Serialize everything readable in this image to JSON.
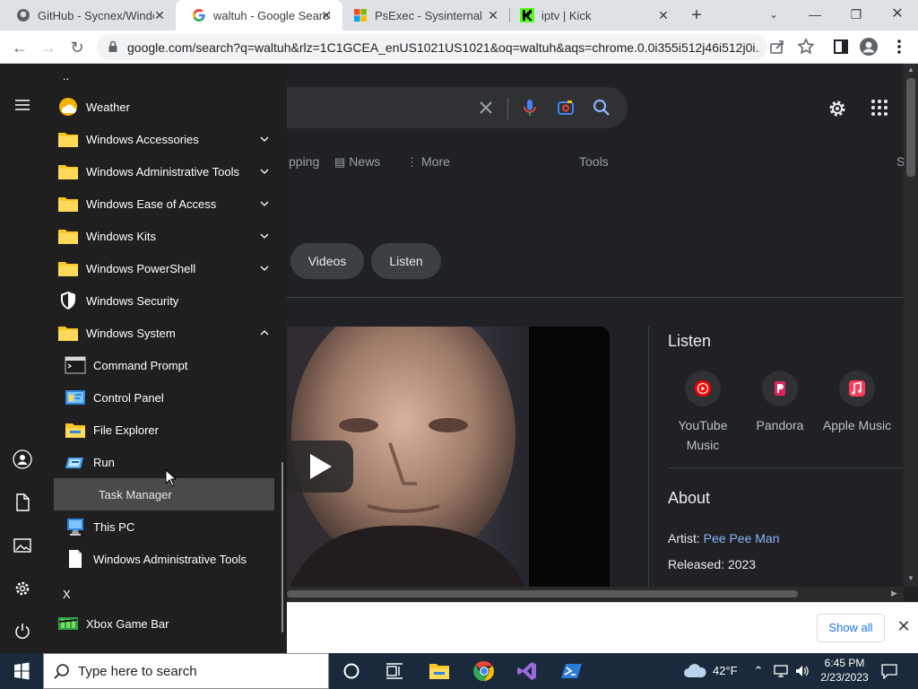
{
  "browser": {
    "tabs": [
      {
        "title": "GitHub - Sycnex/Windo",
        "favicon": "github-icon",
        "active": false
      },
      {
        "title": "waltuh - Google Search",
        "favicon": "google-icon",
        "active": true
      },
      {
        "title": "PsExec - Sysinternals | M",
        "favicon": "microsoft-icon",
        "active": false
      },
      {
        "title": "iptv | Kick",
        "favicon": "kick-icon",
        "active": false
      }
    ],
    "url": "google.com/search?q=waltuh&rlz=1C1GCEA_enUS1021US1021&oq=waltuh&aqs=chrome.0.0i355i512j46i512j0i..."
  },
  "google": {
    "tabs": {
      "shopping_partial": "pping",
      "news": "News",
      "more": "More",
      "tools": "Tools",
      "right_partial": "S"
    },
    "chips": {
      "videos": "Videos",
      "listen": "Listen"
    },
    "knowledge_panel": {
      "listen_heading": "Listen",
      "services": [
        {
          "name": "YouTube Music",
          "color": "#ff0000"
        },
        {
          "name": "Pandora",
          "color": "#e0245e"
        },
        {
          "name": "Apple Music",
          "color": "#fa3c5a"
        }
      ],
      "about_heading": "About",
      "artist_label": "Artist:",
      "artist_value": "Pee Pee Man",
      "released_label": "Released:",
      "released_value": "2023"
    }
  },
  "downloads": {
    "show_all": "Show all"
  },
  "start_menu": {
    "section_dots": "..",
    "weather": "Weather",
    "folders": [
      {
        "label": "Windows Accessories",
        "expanded": false
      },
      {
        "label": "Windows Administrative Tools",
        "expanded": false
      },
      {
        "label": "Windows Ease of Access",
        "expanded": false
      },
      {
        "label": "Windows Kits",
        "expanded": false
      },
      {
        "label": "Windows PowerShell",
        "expanded": false
      }
    ],
    "security": "Windows Security",
    "system_folder": "Windows System",
    "system_items": [
      {
        "label": "Command Prompt",
        "icon": "command-prompt-icon"
      },
      {
        "label": "Control Panel",
        "icon": "control-panel-icon"
      },
      {
        "label": "File Explorer",
        "icon": "file-explorer-icon"
      },
      {
        "label": "Run",
        "icon": "run-icon"
      },
      {
        "label": "Task Manager",
        "icon": "task-manager-icon",
        "highlighted": true
      },
      {
        "label": "This PC",
        "icon": "this-pc-icon"
      },
      {
        "label": "Windows Administrative Tools",
        "icon": "document-icon"
      }
    ],
    "section_x": "X",
    "xbox": "Xbox Game Bar"
  },
  "taskbar": {
    "search_placeholder": "Type here to search",
    "temperature": "42°F",
    "time": "6:45 PM",
    "date": "2/23/2023"
  }
}
